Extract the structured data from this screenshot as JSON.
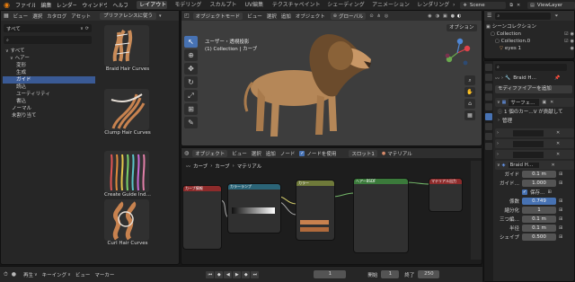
{
  "menubar": {
    "items": [
      "ファイル",
      "編集",
      "レンダー",
      "ウィンドウ",
      "ヘルプ"
    ],
    "workspaces": [
      "レイアウト",
      "モデリング",
      "スカルプト",
      "UV編集",
      "テクスチャペイント",
      "シェーディング",
      "アニメーション",
      "レンダリング"
    ],
    "active_workspace": "レイアウト",
    "scene": "Scene",
    "view_layer": "ViewLayer"
  },
  "asset_browser": {
    "header": [
      "ビュー",
      "選択",
      "カタログ",
      "アセット"
    ],
    "pref_button": "プリファレンスに従う",
    "library": "すべて",
    "tree": [
      {
        "label": "すべて",
        "indent": 0,
        "arrow": "∨",
        "selected": false
      },
      {
        "label": "ヘアー",
        "indent": 1,
        "arrow": "∨",
        "selected": false
      },
      {
        "label": "変形",
        "indent": 2,
        "arrow": "",
        "selected": false
      },
      {
        "label": "生成",
        "indent": 2,
        "arrow": "",
        "selected": false
      },
      {
        "label": "ガイド",
        "indent": 2,
        "arrow": "",
        "selected": true
      },
      {
        "label": "読込",
        "indent": 2,
        "arrow": "",
        "selected": false
      },
      {
        "label": "ユーティリティ",
        "indent": 2,
        "arrow": "",
        "selected": false
      },
      {
        "label": "書込",
        "indent": 2,
        "arrow": "",
        "selected": false
      },
      {
        "label": "ノーマル",
        "indent": 1,
        "arrow": "",
        "selected": false
      },
      {
        "label": "未割り当て",
        "indent": 1,
        "arrow": "",
        "selected": false
      }
    ],
    "assets": [
      "Braid Hair Curves",
      "Clump Hair Curves",
      "Create Guide Ind…",
      "Curl Hair Curves"
    ]
  },
  "viewport": {
    "mode": "オブジェクトモード",
    "menu": [
      "ビュー",
      "選択",
      "追加",
      "オブジェクト"
    ],
    "transform": "グローバル",
    "view_name": "ユーザー・透視投影",
    "collection_info": "(1) Collection | カーブ",
    "options_label": "オプション"
  },
  "node_editor": {
    "mode": "オブジェクト",
    "menu": [
      "ビュー",
      "選択",
      "追加",
      "ノード"
    ],
    "use_nodes_label": "ノードを使用",
    "slot": "スロット1",
    "material_label": "マテリアル",
    "breadcrumb": [
      "カーブ",
      "カーブ",
      "マテリアル"
    ],
    "node_titles": [
      "カーブ情報",
      "カラーランプ",
      "カラー",
      "ヘアーBSDF",
      "マテリアル出力"
    ]
  },
  "timeline": {
    "playback": "再生",
    "keying": "キーイング",
    "menu": [
      "ビュー",
      "マーカー"
    ],
    "current_frame": "1",
    "start_label": "開始",
    "start": "1",
    "end_label": "終了",
    "end": "250"
  },
  "outliner": {
    "root": "シーンコレクション",
    "items": [
      {
        "label": "Collection",
        "indent": 1
      },
      {
        "label": "Collection.0",
        "indent": 2
      },
      {
        "label": "eyes 1",
        "indent": 3
      }
    ]
  },
  "properties": {
    "object_name": "Braid H…",
    "add_modifier": "モディファイアーを追加",
    "modifier_name": "サーフェ…",
    "warning": "1 個のカー…V が貢献して",
    "manage": "管理",
    "panel_name": "Braid H…",
    "fields": [
      {
        "label": "ガイド",
        "value": "0.1 m",
        "style": "normal"
      },
      {
        "label": "ガイド…",
        "value": "1.000",
        "style": "normal"
      },
      {
        "label": "",
        "value": "保存…",
        "style": "check"
      },
      {
        "label": "係数",
        "value": "0.749",
        "style": "blue"
      },
      {
        "label": "縮分化",
        "value": "1",
        "style": "normal"
      },
      {
        "label": "三つ編…",
        "value": "0.1 m",
        "style": "normal"
      },
      {
        "label": "半径",
        "value": "0.1 m",
        "style": "normal"
      },
      {
        "label": "シェイプ",
        "value": "0.500",
        "style": "normal"
      }
    ]
  }
}
